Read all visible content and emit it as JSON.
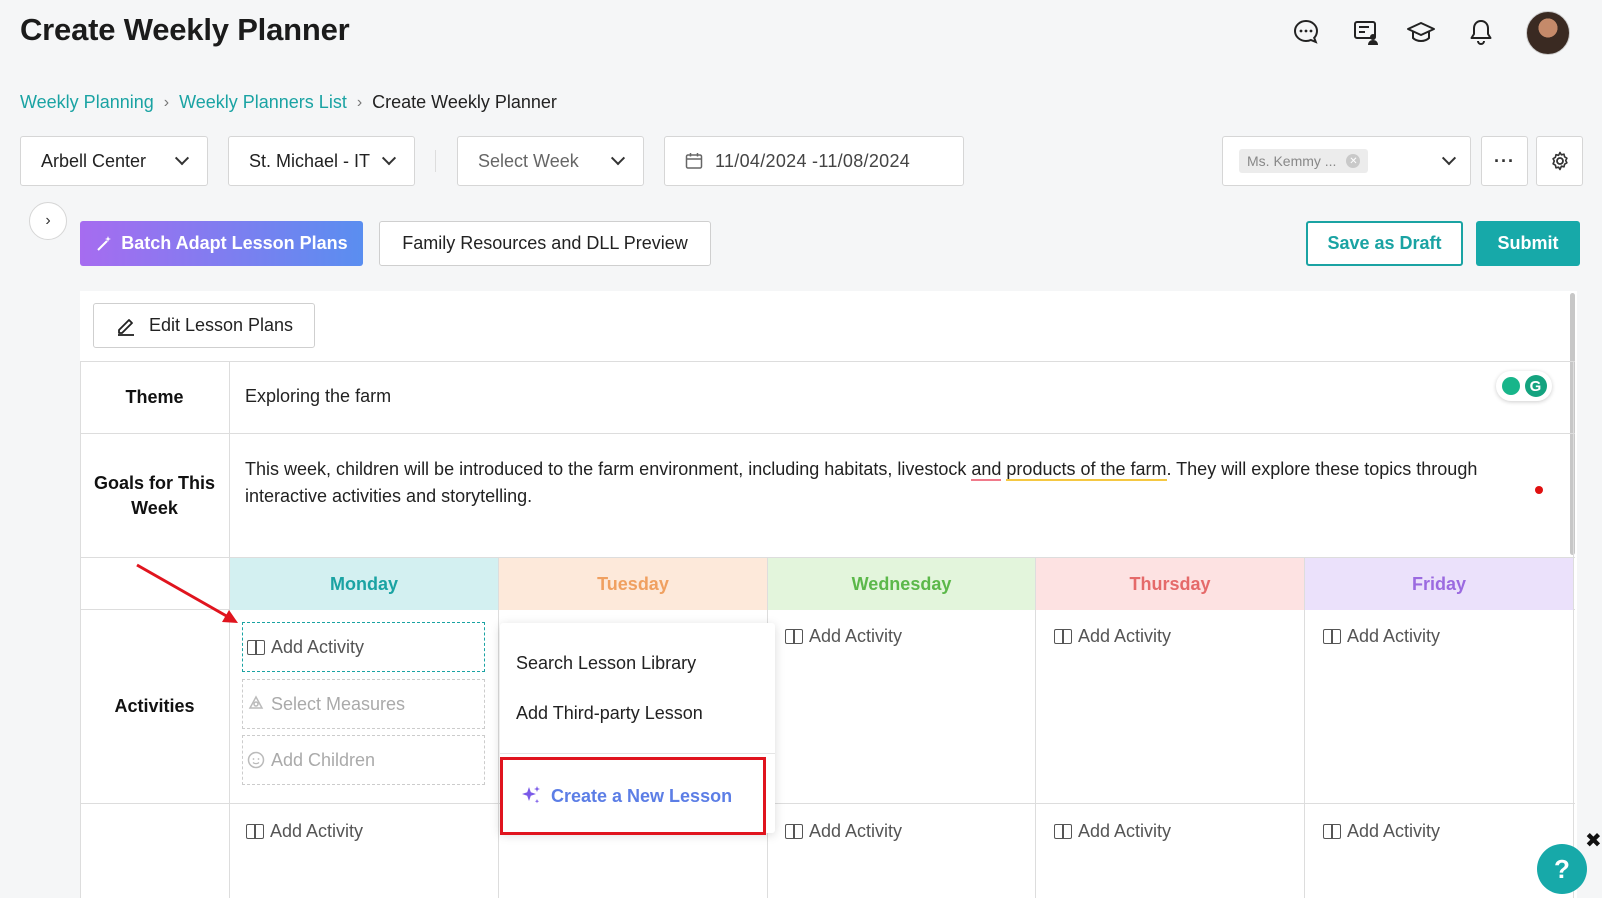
{
  "page_title": "Create Weekly Planner",
  "header_icons": [
    "chat-icon",
    "presentation-icon",
    "graduation-cap-icon",
    "bell-icon"
  ],
  "breadcrumb": {
    "items": [
      "Weekly Planning",
      "Weekly Planners List"
    ],
    "current": "Create Weekly Planner"
  },
  "filters": {
    "center": "Arbell Center",
    "class": "St. Michael - IT",
    "week_placeholder": "Select Week",
    "date_range": "11/04/2024 -11/08/2024",
    "teacher_tag": "Ms. Kemmy ..."
  },
  "toolbar": {
    "more_label": "···",
    "batch_label": "Batch Adapt Lesson Plans",
    "family_label": "Family Resources and DLL Preview",
    "draft_label": "Save as Draft",
    "submit_label": "Submit",
    "edit_label": "Edit Lesson Plans"
  },
  "table": {
    "theme_label": "Theme",
    "theme_value": "Exploring the farm",
    "goals_label": "Goals for This Week",
    "goals_parts": [
      "This week, children will be introduced to the farm environment, including habitats, livestock ",
      "and",
      " ",
      "products of the farm",
      ". They will explore these topics through interactive activities and storytelling."
    ],
    "days": [
      "Monday",
      "Tuesday",
      "Wednesday",
      "Thursday",
      "Friday"
    ],
    "activities_label": "Activities",
    "add_activity": "Add Activity",
    "select_measures": "Select Measures",
    "add_children": "Add Children"
  },
  "popup": {
    "search_library": "Search Lesson Library",
    "third_party": "Add Third-party Lesson",
    "create_new": "Create a New Lesson"
  },
  "help_label": "?",
  "colors": {
    "accent": "#17a9a9",
    "monday_bg": "#d3f0f1",
    "monday_fg": "#1aa3a3",
    "tuesday_bg": "#fde9da",
    "tuesday_fg": "#f0a060",
    "wednesday_bg": "#e3f5dc",
    "wednesday_fg": "#5cb84a",
    "thursday_bg": "#fde2e2",
    "thursday_fg": "#e56a6a",
    "friday_bg": "#ebe1fb",
    "friday_fg": "#9b6ae0"
  }
}
